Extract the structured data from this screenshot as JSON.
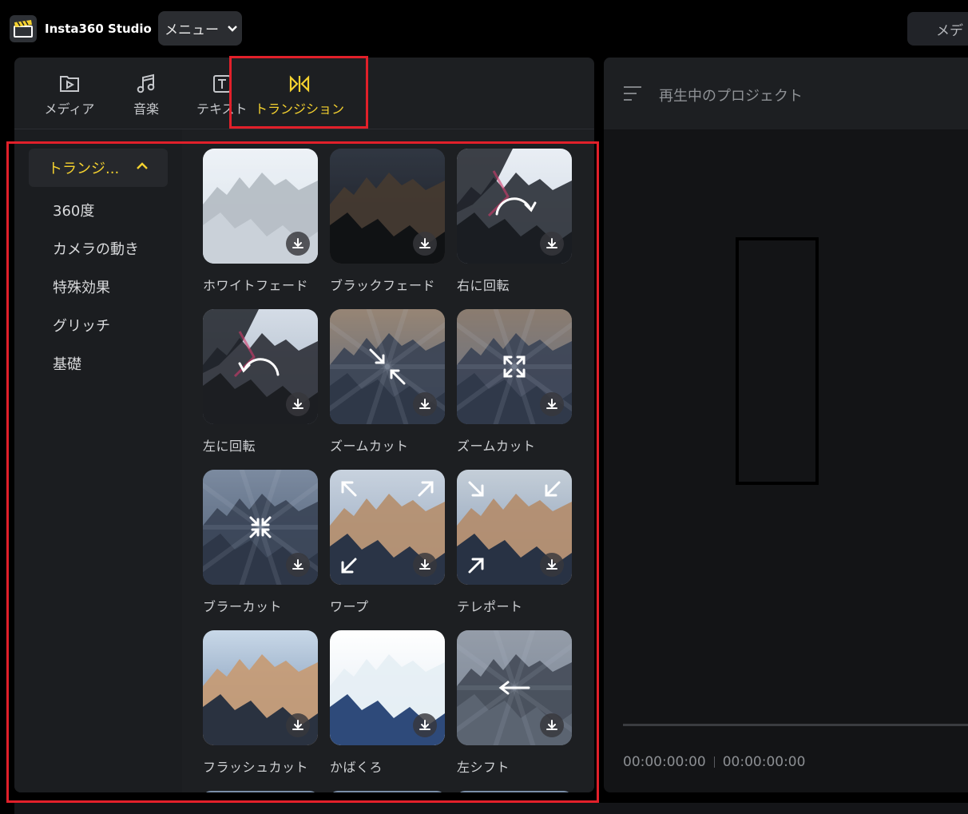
{
  "app": {
    "title": "Insta360 Studio",
    "logo_icon": "clapperboard-icon"
  },
  "topbar": {
    "menu_label": "メニュー",
    "right_button_label": "メデ"
  },
  "tabs": [
    {
      "label": "メディア",
      "icon": "play-file-icon",
      "active": false
    },
    {
      "label": "音楽",
      "icon": "music-note-icon",
      "active": false
    },
    {
      "label": "テキスト",
      "icon": "text-icon",
      "active": false
    },
    {
      "label": "トランジション",
      "icon": "transition-icon",
      "active": true
    }
  ],
  "sidebar": {
    "header": "トランジ...",
    "items": [
      "360度",
      "カメラの動き",
      "特殊効果",
      "グリッチ",
      "基礎"
    ]
  },
  "transitions": [
    {
      "label": "ホワイトフェード",
      "overlay": ""
    },
    {
      "label": "ブラックフェード",
      "overlay": ""
    },
    {
      "label": "右に回転",
      "overlay": "rotate-right-icon"
    },
    {
      "label": "左に回転",
      "overlay": "rotate-left-icon"
    },
    {
      "label": "ズームカット",
      "overlay": "zoom-in-arrows-icon"
    },
    {
      "label": "ズームカット",
      "overlay": "expand-icon"
    },
    {
      "label": "ブラーカット",
      "overlay": "collapse-icon"
    },
    {
      "label": "ワープ",
      "overlay": "corner-arrows-out-icon"
    },
    {
      "label": "テレポート",
      "overlay": "corner-arrows-in-icon"
    },
    {
      "label": "フラッシュカット",
      "overlay": ""
    },
    {
      "label": "かばくろ",
      "overlay": ""
    },
    {
      "label": "左シフト",
      "overlay": "arrow-left-icon"
    }
  ],
  "preview": {
    "title": "再生中のプロジェクト",
    "current_time": "00:00:00:00",
    "total_time": "00:00:00:00"
  },
  "colors": {
    "accent": "#f5d22f",
    "highlight_box": "#e1202a",
    "panel": "#1d1f22",
    "background": "#000000"
  }
}
